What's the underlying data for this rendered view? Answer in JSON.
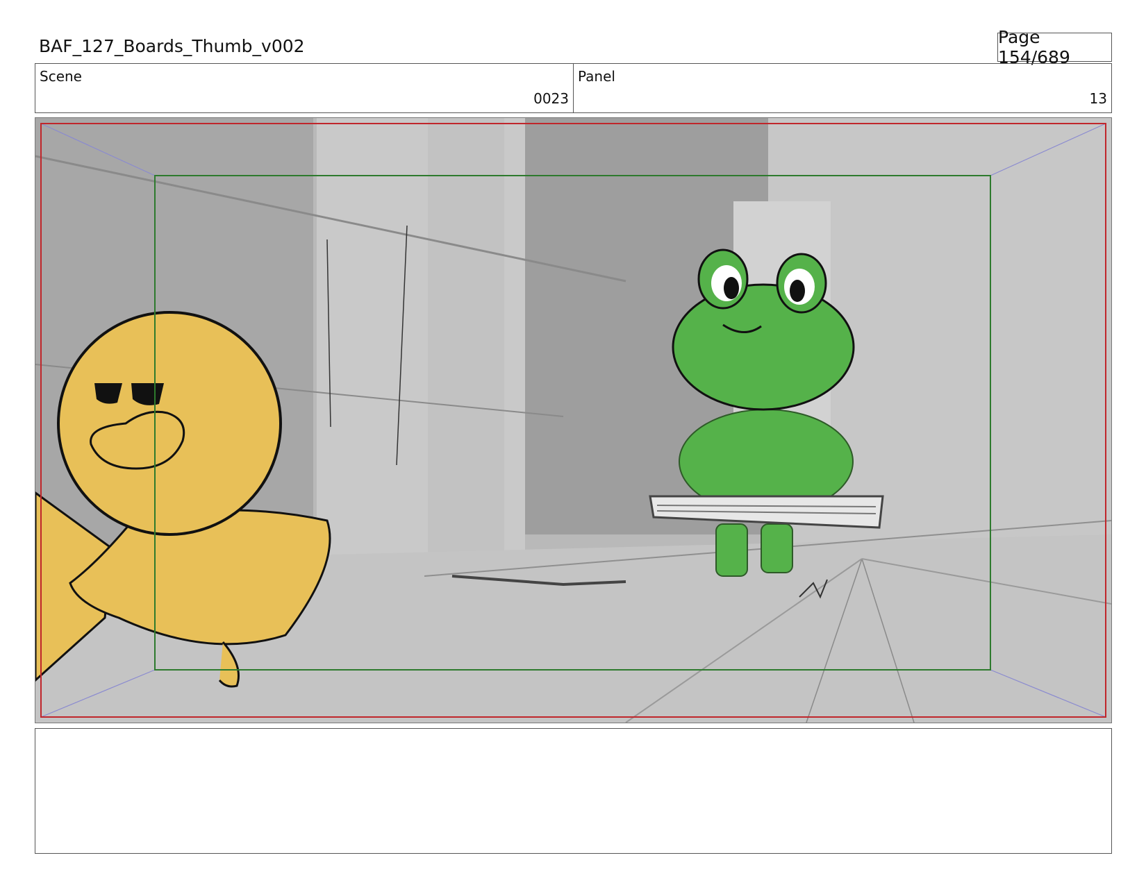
{
  "header": {
    "title": "BAF_127_Boards_Thumb_v002",
    "page": "Page 154/689"
  },
  "info": {
    "scene_label": "Scene",
    "scene_value": "0023",
    "panel_label": "Panel",
    "panel_value": "13"
  },
  "colors": {
    "safe_frame": "#c0262b",
    "action_safe": "#2d7a2d",
    "frog": "#55b24a",
    "duck": "#e8c058"
  },
  "notes": ""
}
